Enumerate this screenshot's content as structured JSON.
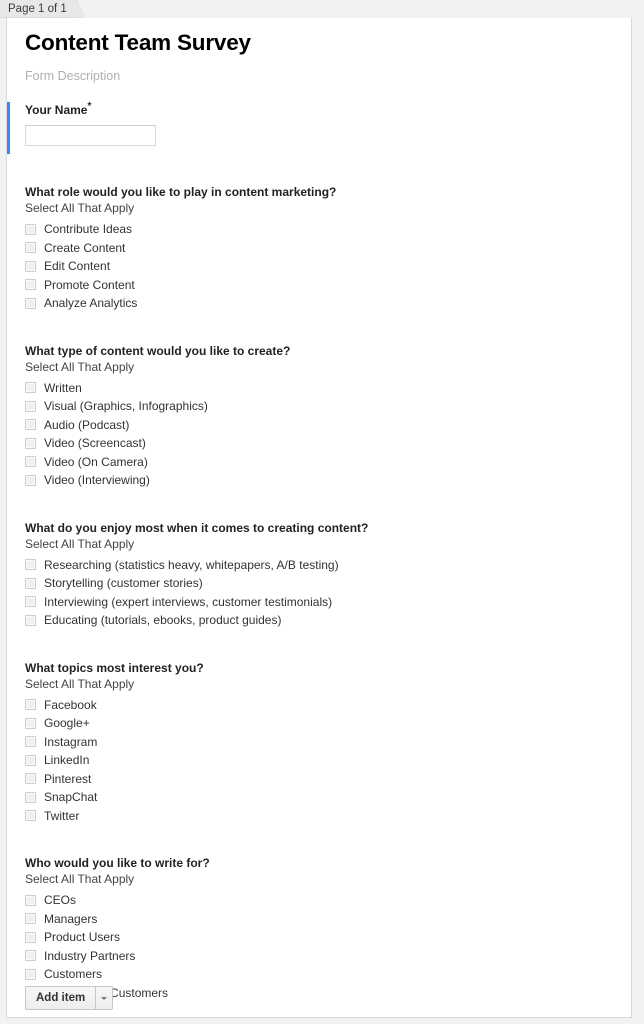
{
  "tab": {
    "label": "Page 1 of 1"
  },
  "form": {
    "title": "Content Team Survey",
    "description_placeholder": "Form Description"
  },
  "items": [
    {
      "type": "text",
      "title": "Your Name",
      "required": true,
      "required_marker": "*",
      "value": "",
      "active": true
    },
    {
      "type": "checkboxes",
      "title": "What role would you like to play in content marketing?",
      "help": "Select All That Apply",
      "options": [
        "Contribute Ideas",
        "Create Content",
        "Edit Content",
        "Promote Content",
        "Analyze Analytics"
      ]
    },
    {
      "type": "checkboxes",
      "title": "What type of content would you like to create?",
      "help": "Select All That Apply",
      "options": [
        "Written",
        "Visual (Graphics, Infographics)",
        "Audio (Podcast)",
        "Video (Screencast)",
        "Video (On Camera)",
        "Video (Interviewing)"
      ]
    },
    {
      "type": "checkboxes",
      "title": "What do you enjoy most when it comes to creating content?",
      "help": "Select All That Apply",
      "options": [
        "Researching (statistics heavy, whitepapers, A/B testing)",
        "Storytelling (customer stories)",
        "Interviewing (expert interviews, customer testimonials)",
        "Educating (tutorials, ebooks, product guides)"
      ]
    },
    {
      "type": "checkboxes",
      "title": "What topics most interest you?",
      "help": "Select All That Apply",
      "options": [
        "Facebook",
        "Google+",
        "Instagram",
        "LinkedIn",
        "Pinterest",
        "SnapChat",
        "Twitter"
      ]
    },
    {
      "type": "checkboxes",
      "title": "Who would you like to write for?",
      "help": "Select All That Apply",
      "options": [
        "CEOs",
        "Managers",
        "Product Users",
        "Industry Partners",
        "Customers",
        "Prospective Customers"
      ]
    }
  ],
  "footer": {
    "add_item_label": "Add item",
    "caret_icon": "chevron-down-icon"
  },
  "colors": {
    "active_accent": "#4285f4",
    "page_background": "#f2f2f2",
    "sheet_background": "#ffffff",
    "tab_background": "#e8e8e8"
  }
}
